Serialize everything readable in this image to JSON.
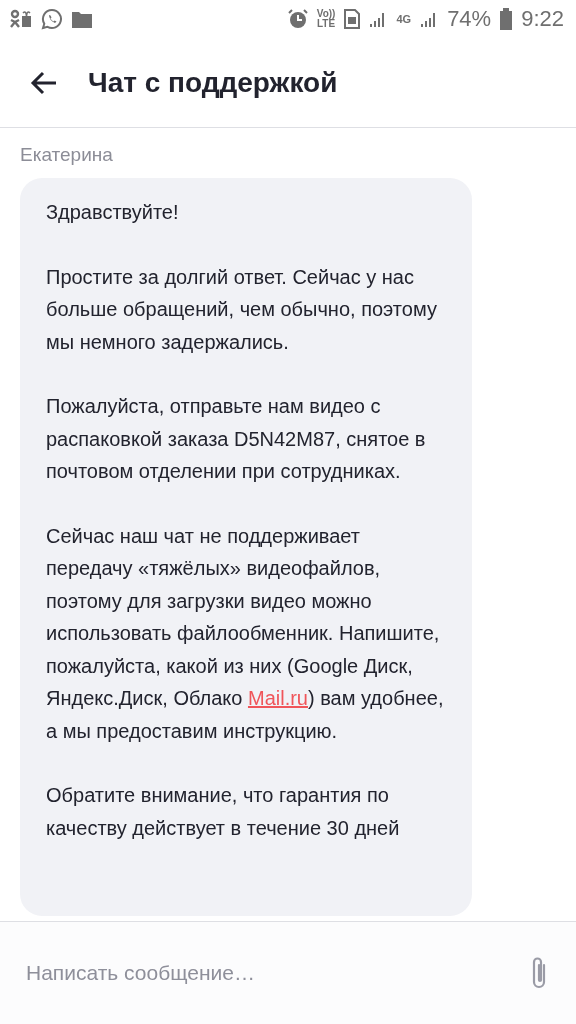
{
  "status_bar": {
    "volte": [
      "Vo))",
      "LTE"
    ],
    "network": "4G",
    "battery": "74%",
    "time": "9:22"
  },
  "header": {
    "title": "Чат с поддержкой"
  },
  "messages": [
    {
      "sender": "Екатерина",
      "paragraphs": [
        {
          "text": "Здравствуйте!"
        },
        {
          "text": "Простите за долгий ответ. Сейчас у нас больше обращений, чем обычно, поэтому мы немного задержались."
        },
        {
          "text": "Пожалуйста, отправьте нам видео с распаковкой заказа D5N42M87, снятое в почтовом отделении при сотрудниках."
        },
        {
          "text": "Сейчас наш чат не поддерживает передачу «тяжёлых» видеофайлов, поэтому для загрузки видео можно использовать файлообменник. Напишите, пожалуйста, какой из них (Google Диск, Яндекс.Диск, Облако",
          "link": "Mail.ru",
          "after": ") вам удобнее, а мы предоставим инструкцию."
        },
        {
          "text": "Обратите внимание, что гарантия по качеству действует в течение 30 дней"
        }
      ]
    }
  ],
  "composer": {
    "placeholder": "Написать сообщение…"
  }
}
